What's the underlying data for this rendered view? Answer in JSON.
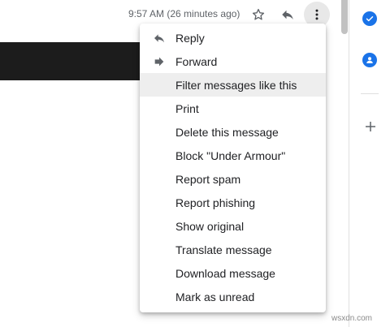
{
  "header": {
    "timestamp": "9:57 AM (26 minutes ago)"
  },
  "menu": {
    "items": [
      {
        "label": "Reply",
        "icon": "reply-icon"
      },
      {
        "label": "Forward",
        "icon": "forward-icon"
      },
      {
        "label": "Filter messages like this"
      },
      {
        "label": "Print"
      },
      {
        "label": "Delete this message"
      },
      {
        "label": "Block \"Under Armour\""
      },
      {
        "label": "Report spam"
      },
      {
        "label": "Report phishing"
      },
      {
        "label": "Show original"
      },
      {
        "label": "Translate message"
      },
      {
        "label": "Download message"
      },
      {
        "label": "Mark as unread"
      }
    ],
    "highlighted": "Filter messages like this"
  },
  "side_panel": {
    "icons": [
      "tasks-icon",
      "contacts-icon",
      "add-icon"
    ]
  },
  "watermark": "wsxdn.com",
  "colors": {
    "accent": "#1a73e8",
    "icon_grey": "#5f6368",
    "hover": "#eeeeee",
    "dark_bar": "#1c1c1c"
  }
}
